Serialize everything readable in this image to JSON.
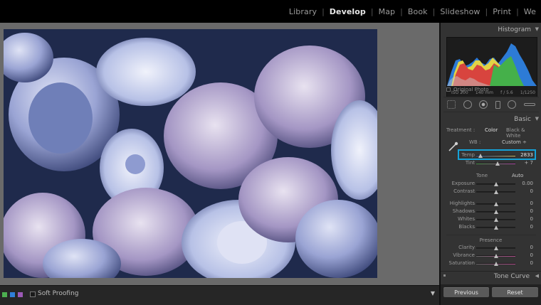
{
  "modules": [
    "Library",
    "Develop",
    "Map",
    "Book",
    "Slideshow",
    "Print",
    "We"
  ],
  "active_module": "Develop",
  "toolbar": {
    "soft_proofing_label": "Soft Proofing",
    "color_label_colors": [
      "#4caf50",
      "#2f7fd8",
      "#9b59b6"
    ]
  },
  "histogram": {
    "title": "Histogram",
    "iso": "ISO 200",
    "focal": "140 mm",
    "aperture": "f / 5.6",
    "shutter": "1/1250",
    "original_photo_label": "Original Photo"
  },
  "basic": {
    "title": "Basic",
    "treatment_label": "Treatment :",
    "treatment_color": "Color",
    "treatment_bw": "Black & White",
    "wb_label": "WB :",
    "wb_value": "Custom ÷",
    "sliders": {
      "temp": {
        "label": "Temp",
        "value": "2833",
        "position": 0.1
      },
      "tint": {
        "label": "Tint",
        "value": "+ 7",
        "position": 0.55
      },
      "exposure": {
        "label": "Exposure",
        "value": "0.00",
        "position": 0.5
      },
      "contrast": {
        "label": "Contrast",
        "value": "0",
        "position": 0.5
      },
      "highlights": {
        "label": "Highlights",
        "value": "0",
        "position": 0.5
      },
      "shadows": {
        "label": "Shadows",
        "value": "0",
        "position": 0.5
      },
      "whites": {
        "label": "Whites",
        "value": "0",
        "position": 0.5
      },
      "blacks": {
        "label": "Blacks",
        "value": "0",
        "position": 0.5
      },
      "clarity": {
        "label": "Clarity",
        "value": "0",
        "position": 0.5
      },
      "vibrance": {
        "label": "Vibrance",
        "value": "0",
        "position": 0.5
      },
      "saturation": {
        "label": "Saturation",
        "value": "0",
        "position": 0.5
      }
    },
    "tone_label": "Tone",
    "auto_label": "Auto",
    "presence_label": "Presence"
  },
  "tone_curve": {
    "title": "Tone Curve"
  },
  "buttons": {
    "previous": "Previous",
    "reset": "Reset"
  },
  "colors": {
    "highlight_box": "#15a2d8"
  }
}
